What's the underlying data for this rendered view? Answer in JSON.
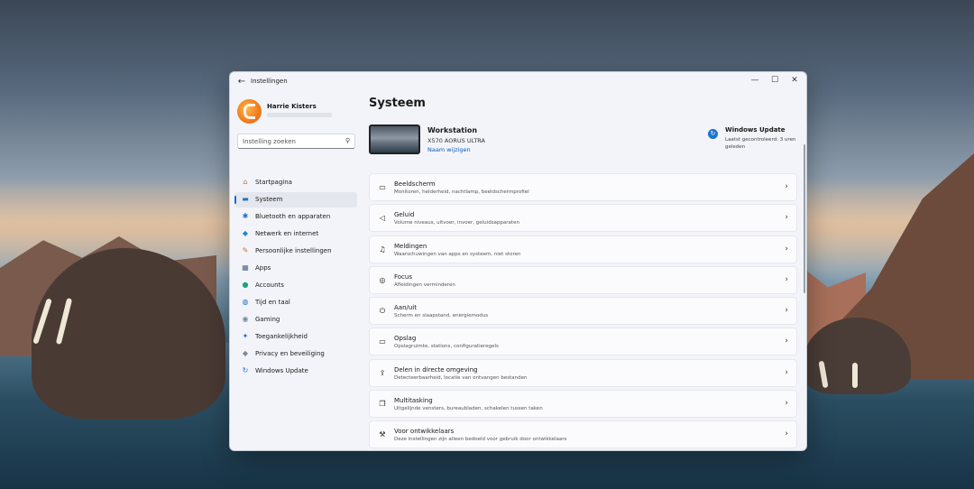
{
  "window": {
    "title": "Instellingen"
  },
  "profile": {
    "name": "Harrie Kisters"
  },
  "search": {
    "placeholder": "Instelling zoeken"
  },
  "sidebar": {
    "items": [
      {
        "label": "Startpagina",
        "icon": "home-icon",
        "glyph": "⌂",
        "color": "#c0763a"
      },
      {
        "label": "Systeem",
        "icon": "display-icon",
        "glyph": "▬",
        "color": "#1a73d1",
        "active": true
      },
      {
        "label": "Bluetooth en apparaten",
        "icon": "bluetooth-icon",
        "glyph": "✱",
        "color": "#1a73d1"
      },
      {
        "label": "Netwerk en internet",
        "icon": "wifi-icon",
        "glyph": "◆",
        "color": "#1e88d8"
      },
      {
        "label": "Persoonlijke instellingen",
        "icon": "brush-icon",
        "glyph": "✎",
        "color": "#d36a3a"
      },
      {
        "label": "Apps",
        "icon": "apps-icon",
        "glyph": "▦",
        "color": "#4a6b8a"
      },
      {
        "label": "Accounts",
        "icon": "account-icon",
        "glyph": "●",
        "color": "#1aa37a"
      },
      {
        "label": "Tijd en taal",
        "icon": "globe-icon",
        "glyph": "◍",
        "color": "#1a73d1"
      },
      {
        "label": "Gaming",
        "icon": "gamepad-icon",
        "glyph": "◉",
        "color": "#7a8898"
      },
      {
        "label": "Toegankelijkheid",
        "icon": "accessibility-icon",
        "glyph": "✦",
        "color": "#1a73d1"
      },
      {
        "label": "Privacy en beveiliging",
        "icon": "shield-icon",
        "glyph": "◆",
        "color": "#7a8898"
      },
      {
        "label": "Windows Update",
        "icon": "update-icon",
        "glyph": "↻",
        "color": "#1a73d1"
      }
    ]
  },
  "main": {
    "title": "Systeem",
    "device": {
      "name": "Workstation",
      "model": "X570 AORUS ULTRA",
      "rename": "Naam wijzigen"
    },
    "windows_update": {
      "title": "Windows Update",
      "status": "Laatst gecontroleerd: 3 uren geleden"
    },
    "cards": [
      {
        "title": "Beeldscherm",
        "subtitle": "Monitoren, helderheid, nachtlamp, beeldschermprofiel",
        "icon": "monitor-icon",
        "glyph": "▭"
      },
      {
        "title": "Geluid",
        "subtitle": "Volume niveaus, uitvoer, invoer, geluidsapparaten",
        "icon": "speaker-icon",
        "glyph": "◁"
      },
      {
        "title": "Meldingen",
        "subtitle": "Waarschuwingen van apps en systeem, niet storen",
        "icon": "bell-icon",
        "glyph": "♫"
      },
      {
        "title": "Focus",
        "subtitle": "Afleidingen verminderen",
        "icon": "focus-icon",
        "glyph": "◎"
      },
      {
        "title": "Aan/uit",
        "subtitle": "Scherm en slaapstand, energiemodus",
        "icon": "power-icon",
        "glyph": "⏻"
      },
      {
        "title": "Opslag",
        "subtitle": "Opslagruimte, stations, configuratieregels",
        "icon": "storage-icon",
        "glyph": "▭"
      },
      {
        "title": "Delen in directe omgeving",
        "subtitle": "Detecteerbaarheid, locatie van ontvangen bestanden",
        "icon": "share-icon",
        "glyph": "⇪"
      },
      {
        "title": "Multitasking",
        "subtitle": "Uitgelijnde vensters, bureaubladen, schakelen tussen taken",
        "icon": "multitask-icon",
        "glyph": "❐"
      },
      {
        "title": "Voor ontwikkelaars",
        "subtitle": "Deze instellingen zijn alleen bedoeld voor gebruik door ontwikkelaars",
        "icon": "developer-icon",
        "glyph": "⚒"
      }
    ]
  },
  "colors": {
    "accent": "#1868c9",
    "window_bg": "#f2f4f9",
    "card_bg": "#fbfbfd"
  }
}
